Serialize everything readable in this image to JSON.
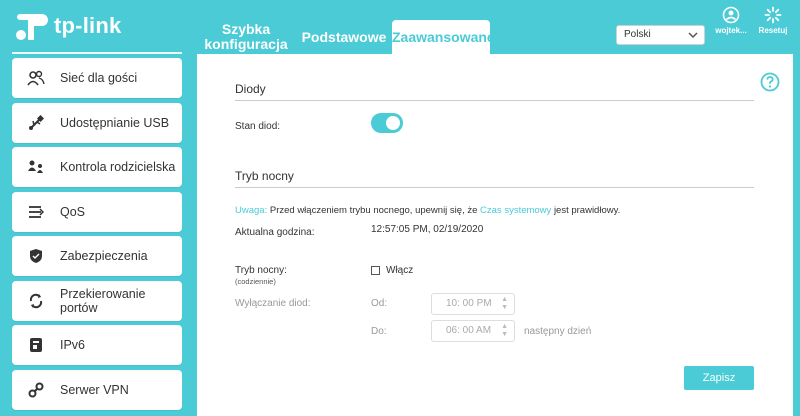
{
  "header": {
    "logo_text": "tp-link",
    "tabs": [
      {
        "label_line1": "Szybka",
        "label_line2": "konfiguracja"
      },
      {
        "label": "Podstawowe"
      },
      {
        "label": "Zaawansowane"
      }
    ],
    "language": "Polski",
    "user_label": "wojtek...",
    "reset_label": "Resetuj"
  },
  "sidebar": {
    "items": [
      {
        "label": "Sieć dla gości",
        "icon": "guest-network-icon"
      },
      {
        "label": "Udostępnianie USB",
        "icon": "usb-icon"
      },
      {
        "label": "Kontrola rodzicielska",
        "icon": "parental-control-icon"
      },
      {
        "label": "QoS",
        "icon": "qos-icon"
      },
      {
        "label": "Zabezpieczenia",
        "icon": "shield-icon"
      },
      {
        "label_line1": "Przekierowanie",
        "label_line2": "portów",
        "icon": "port-forwarding-icon"
      },
      {
        "label": "IPv6",
        "icon": "ipv6-icon"
      },
      {
        "label": "Serwer VPN",
        "icon": "vpn-icon"
      }
    ]
  },
  "leds": {
    "title": "Diody",
    "status_label": "Stan diod:",
    "status_on": true
  },
  "night": {
    "title": "Tryb nocny",
    "note_warn": "Uwaga:",
    "note_text": "Przed włączeniem trybu nocnego, upewnij się, że",
    "note_link": "Czas systemowy",
    "note_end": "jest prawidłowy.",
    "current_time_label": "Aktualna godzina:",
    "current_time_value": "12:57:05 PM, 02/19/2020",
    "mode_label": "Tryb nocny:",
    "mode_sub": "(codziennie)",
    "enable_label": "Włącz",
    "enabled": false,
    "off_label": "Wyłączanie diod:",
    "from_label": "Od:",
    "from_value": "10: 00 PM",
    "to_label": "Do:",
    "to_value": "06: 00 AM",
    "next_day": "następny dzień"
  },
  "save_label": "Zapisz",
  "colors": {
    "accent": "#4acbd6"
  }
}
